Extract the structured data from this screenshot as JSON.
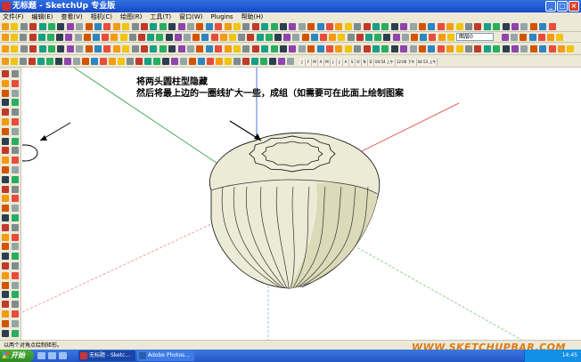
{
  "window": {
    "title": "无标题 - SketchUp 专业版",
    "buttons": [
      "_",
      "□",
      "×"
    ]
  },
  "menu": [
    "文件(F)",
    "编辑(E)",
    "查看(V)",
    "相机(C)",
    "绘图(R)",
    "工具(T)",
    "窗口(W)",
    "Plugins",
    "帮助(H)"
  ],
  "layer": {
    "current": "图层0"
  },
  "timeline": {
    "months": [
      "J",
      "F",
      "M",
      "A",
      "M",
      "J",
      "J",
      "A",
      "S",
      "O",
      "N",
      "D"
    ],
    "time1": "04:54 上午",
    "time2": "12:00 下午",
    "time3": "04:53 上午"
  },
  "annotation": {
    "line1": "将两头圆柱型隐藏",
    "line2": "然后将最上边的一圈线扩大一些，成组（如需要可在此面上绘制图案"
  },
  "status": "以两个对角点绘制矩形。",
  "watermark": "WWW.SKETCHUPBAR.COM",
  "taskbar": {
    "start": "开始",
    "tasks": [
      "无标题 - Sketc...",
      "Adobe Photos..."
    ],
    "clock": "14:45"
  },
  "colors": {
    "title_blue": "#1549c8",
    "dome_fill": "#ecebd5",
    "axis_red": "#e25a5a",
    "axis_green": "#4caf50",
    "axis_blue": "#4f7ad8",
    "watermark": "#e07a10"
  }
}
